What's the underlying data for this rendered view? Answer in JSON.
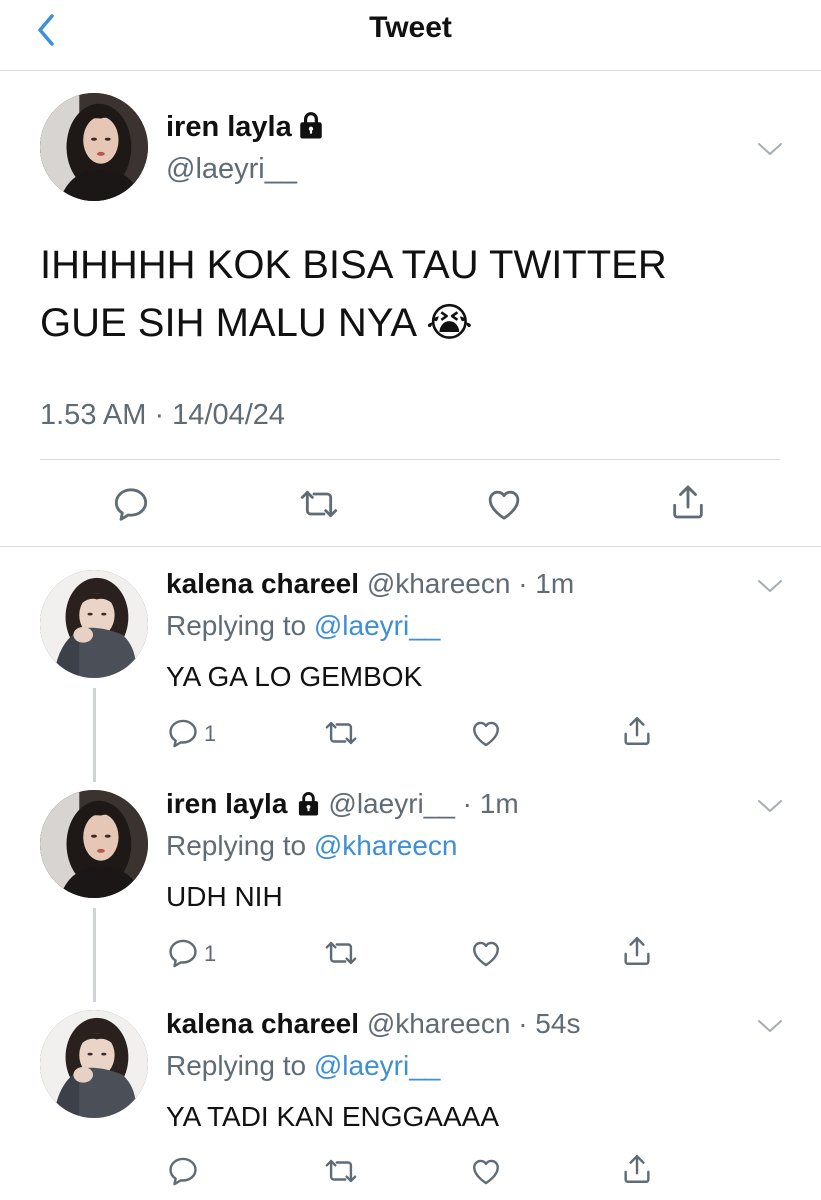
{
  "header": {
    "title": "Tweet"
  },
  "main_tweet": {
    "name": "iren layla",
    "handle": "@laeyri__",
    "text_line1": "IHHHHH KOK BISA TAU TWITTER",
    "text_line2": "GUE SIH MALU NYA 😭",
    "timestamp": "1.53 AM · 14/04/24"
  },
  "replies": [
    {
      "name": "kalena chareel",
      "handle_time": "@khareecn · 1m",
      "replying_prefix": "Replying to ",
      "replying_to": "@laeyri__",
      "text": "YA GA LO GEMBOK",
      "reply_count": "1"
    },
    {
      "name": "iren layla",
      "handle_time": "@laeyri__ · 1m",
      "replying_prefix": "Replying to ",
      "replying_to": "@khareecn",
      "text": "UDH NIH",
      "reply_count": "1"
    },
    {
      "name": "kalena chareel",
      "handle_time": "@khareecn · 54s",
      "replying_prefix": "Replying to ",
      "replying_to": "@laeyri__",
      "text": "YA TADI KAN ENGGAAAA",
      "reply_count": ""
    }
  ],
  "colors": {
    "accent": "#3d8fd6",
    "muted": "#5f6b75",
    "divider": "#d9d9d9"
  },
  "icons": [
    "back-chevron-icon",
    "lock-icon",
    "chevron-down-icon",
    "reply-icon",
    "retweet-icon",
    "like-icon",
    "share-icon"
  ]
}
